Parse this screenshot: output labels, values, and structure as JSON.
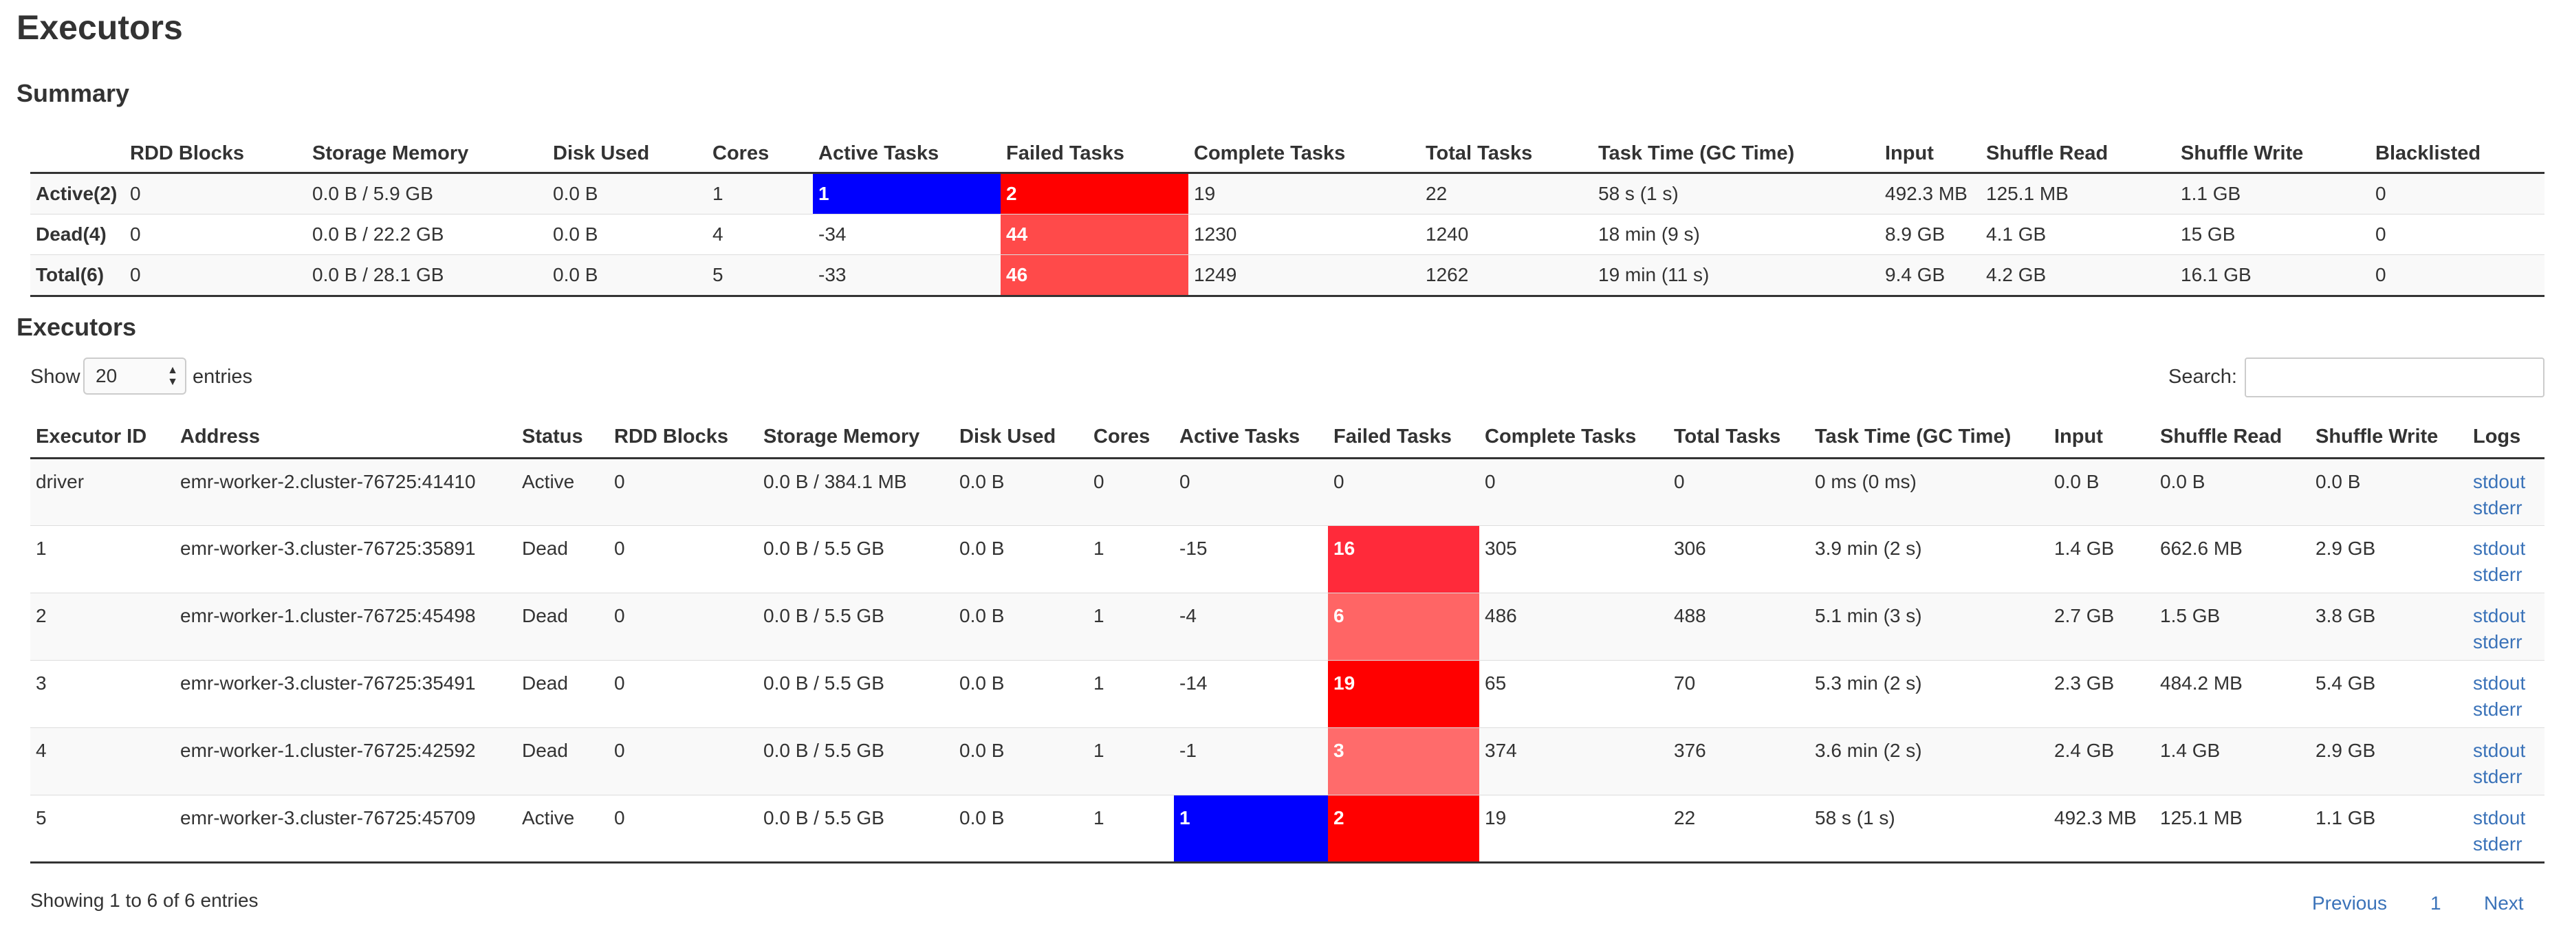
{
  "page_title": "Executors",
  "summary": {
    "heading": "Summary",
    "columns": [
      "",
      "RDD Blocks",
      "Storage Memory",
      "Disk Used",
      "Cores",
      "Active Tasks",
      "Failed Tasks",
      "Complete Tasks",
      "Total Tasks",
      "Task Time (GC Time)",
      "Input",
      "Shuffle Read",
      "Shuffle Write",
      "Blacklisted"
    ],
    "rows": [
      [
        "Active(2)",
        "0",
        "0.0 B / 5.9 GB",
        "0.0 B",
        "1",
        "1",
        "2",
        "19",
        "22",
        "58 s (1 s)",
        "492.3 MB",
        "125.1 MB",
        "1.1 GB",
        "0"
      ],
      [
        "Dead(4)",
        "0",
        "0.0 B / 22.2 GB",
        "0.0 B",
        "4",
        "-34",
        "44",
        "1230",
        "1240",
        "18 min (9 s)",
        "8.9 GB",
        "4.1 GB",
        "15 GB",
        "0"
      ],
      [
        "Total(6)",
        "0",
        "0.0 B / 28.1 GB",
        "0.0 B",
        "5",
        "-33",
        "46",
        "1249",
        "1262",
        "19 min (11 s)",
        "9.4 GB",
        "4.2 GB",
        "16.1 GB",
        "0"
      ]
    ],
    "active_cell_colors": [
      "#0000ff",
      "",
      ""
    ],
    "failed_cell_colors": [
      "#ff0000",
      "#ff4a4a",
      "#ff4a4a"
    ]
  },
  "executors": {
    "heading": "Executors",
    "show_label": "Show",
    "entries_value": "20",
    "entries_label": "entries",
    "search_label": "Search:",
    "search_value": "",
    "columns": [
      "Executor ID",
      "Address",
      "Status",
      "RDD Blocks",
      "Storage Memory",
      "Disk Used",
      "Cores",
      "Active Tasks",
      "Failed Tasks",
      "Complete Tasks",
      "Total Tasks",
      "Task Time (GC Time)",
      "Input",
      "Shuffle Read",
      "Shuffle Write",
      "Logs"
    ],
    "rows": [
      [
        "driver",
        "emr-worker-2.cluster-76725:41410",
        "Active",
        "0",
        "0.0 B / 384.1 MB",
        "0.0 B",
        "0",
        "0",
        "0",
        "0",
        "0",
        "0 ms (0 ms)",
        "0.0 B",
        "0.0 B",
        "0.0 B"
      ],
      [
        "1",
        "emr-worker-3.cluster-76725:35891",
        "Dead",
        "0",
        "0.0 B / 5.5 GB",
        "0.0 B",
        "1",
        "-15",
        "16",
        "305",
        "306",
        "3.9 min (2 s)",
        "1.4 GB",
        "662.6 MB",
        "2.9 GB"
      ],
      [
        "2",
        "emr-worker-1.cluster-76725:45498",
        "Dead",
        "0",
        "0.0 B / 5.5 GB",
        "0.0 B",
        "1",
        "-4",
        "6",
        "486",
        "488",
        "5.1 min (3 s)",
        "2.7 GB",
        "1.5 GB",
        "3.8 GB"
      ],
      [
        "3",
        "emr-worker-3.cluster-76725:35491",
        "Dead",
        "0",
        "0.0 B / 5.5 GB",
        "0.0 B",
        "1",
        "-14",
        "19",
        "65",
        "70",
        "5.3 min (2 s)",
        "2.3 GB",
        "484.2 MB",
        "5.4 GB"
      ],
      [
        "4",
        "emr-worker-1.cluster-76725:42592",
        "Dead",
        "0",
        "0.0 B / 5.5 GB",
        "0.0 B",
        "1",
        "-1",
        "3",
        "374",
        "376",
        "3.6 min (2 s)",
        "2.4 GB",
        "1.4 GB",
        "2.9 GB"
      ],
      [
        "5",
        "emr-worker-3.cluster-76725:45709",
        "Active",
        "0",
        "0.0 B / 5.5 GB",
        "0.0 B",
        "1",
        "1",
        "2",
        "19",
        "22",
        "58 s (1 s)",
        "492.3 MB",
        "125.1 MB",
        "1.1 GB"
      ]
    ],
    "log_links": [
      "stdout",
      "stderr"
    ],
    "active_cell_colors": [
      "",
      "",
      "",
      "",
      "",
      "#0000ff"
    ],
    "failed_cell_colors": [
      "",
      "#ff2a3a",
      "#ff6565",
      "#ff0000",
      "#ff6b6b",
      "#ff0000"
    ],
    "footer_info": "Showing 1 to 6 of 6 entries",
    "pagination": [
      "Previous",
      "1",
      "Next"
    ]
  }
}
